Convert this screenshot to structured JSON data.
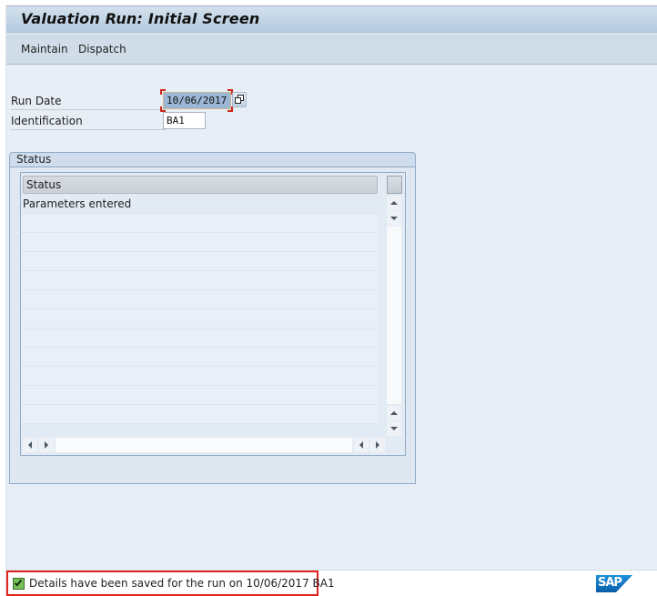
{
  "window": {
    "title": "Valuation Run: Initial Screen"
  },
  "menu": {
    "items": [
      {
        "label": "Maintain"
      },
      {
        "label": "Dispatch"
      }
    ]
  },
  "form": {
    "run_date": {
      "label": "Run Date",
      "value": "10/06/2017",
      "help_icon": "value-help-icon"
    },
    "identification": {
      "label": "Identification",
      "value": "BA1"
    }
  },
  "status_group": {
    "title": "Status",
    "table": {
      "columns": [
        "Status"
      ],
      "rows": [
        {
          "status": "Parameters entered"
        },
        {
          "status": ""
        },
        {
          "status": ""
        },
        {
          "status": ""
        },
        {
          "status": ""
        },
        {
          "status": ""
        },
        {
          "status": ""
        },
        {
          "status": ""
        },
        {
          "status": ""
        },
        {
          "status": ""
        },
        {
          "status": ""
        },
        {
          "status": ""
        }
      ]
    }
  },
  "statusbar": {
    "icon": "success-check-icon",
    "message": "Details have been saved for the run on 10/06/2017 BA1",
    "logo": "SAP"
  },
  "colors": {
    "highlight_border": "#e0231c",
    "success_green": "#78c25a",
    "sap_blue": "#1d8fdc"
  }
}
